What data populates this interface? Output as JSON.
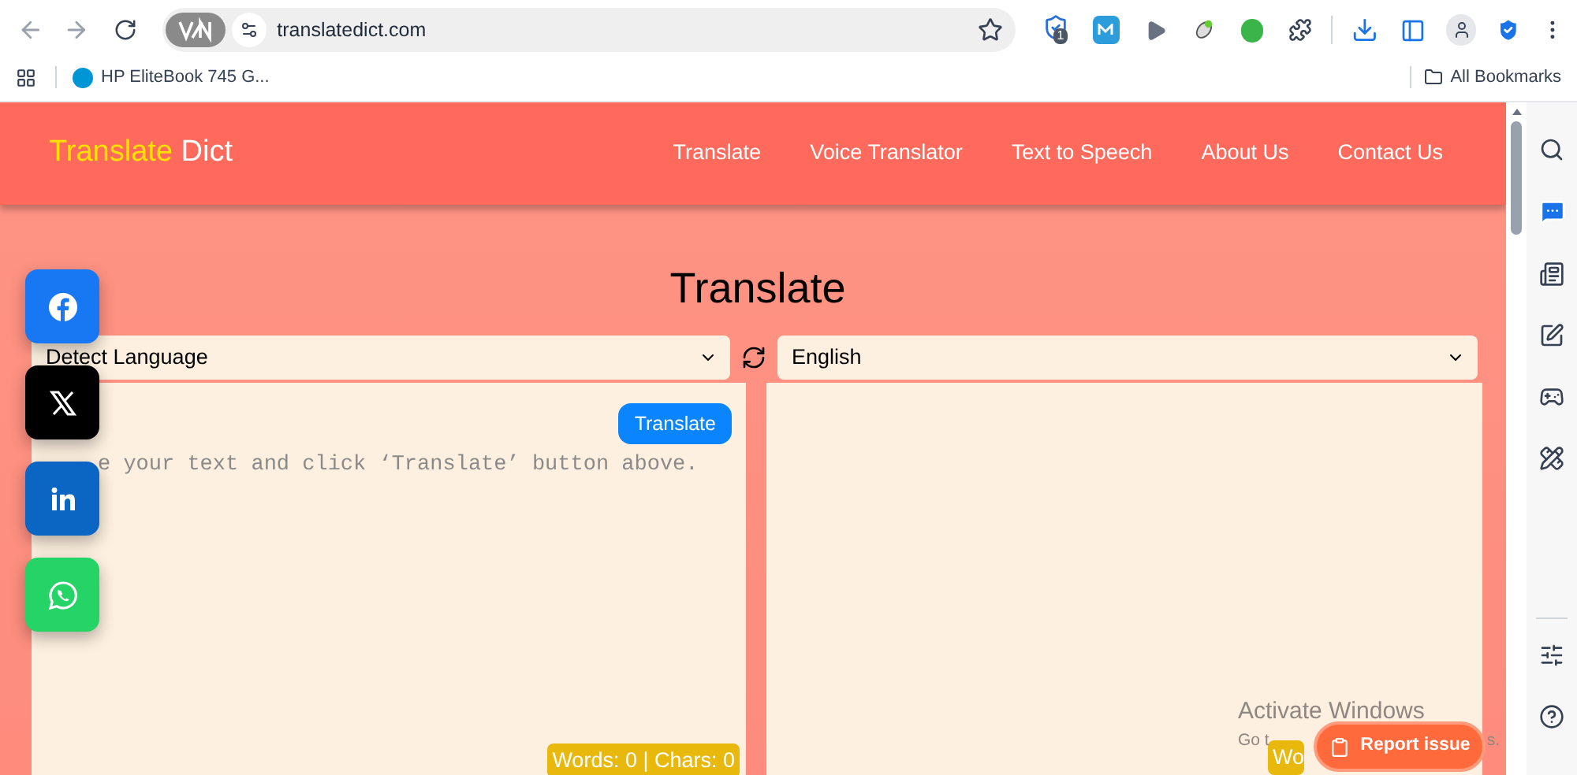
{
  "browser": {
    "url": "translatedict.com",
    "extension_badge": "1",
    "bookmarks": [
      {
        "label": "HP EliteBook 745 G..."
      }
    ],
    "all_bookmarks": "All Bookmarks"
  },
  "site": {
    "logo": {
      "first": "Translate",
      "second": "Dict"
    },
    "nav": [
      {
        "label": "Translate"
      },
      {
        "label": "Voice Translator"
      },
      {
        "label": "Text to Speech"
      },
      {
        "label": "About Us"
      },
      {
        "label": "Contact Us"
      }
    ],
    "title": "Translate",
    "source_language": "Detect Language",
    "target_language": "English",
    "translate_button": "Translate",
    "source_placeholder": "e your text and click ‘Translate’ button above.",
    "source_counter": "Words: 0 | Chars: 0",
    "target_counter": "Wo",
    "report_button": "Report issue"
  },
  "os_notice": {
    "title": "Activate Windows",
    "line_start": "Go t",
    "line_end": "s."
  }
}
